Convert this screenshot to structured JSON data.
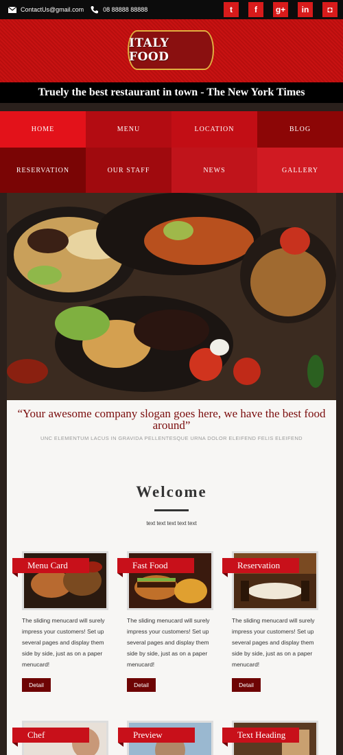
{
  "topbar": {
    "email": "ContactUs@gmail.com",
    "phone": "08 88888 88888",
    "social": [
      {
        "icon": "twitter-icon",
        "glyph": "t"
      },
      {
        "icon": "facebook-icon",
        "glyph": "f"
      },
      {
        "icon": "googleplus-icon",
        "glyph": "g+"
      },
      {
        "icon": "linkedin-icon",
        "glyph": "in"
      },
      {
        "icon": "instagram-icon",
        "glyph": "◘"
      }
    ]
  },
  "header": {
    "logo_text": "ITALY FOOD",
    "tagline": "Truely the best restaurant in town - The New York Times"
  },
  "nav": {
    "items": [
      {
        "label": "HOME",
        "color": "#e3121a"
      },
      {
        "label": "MENU",
        "color": "#b30c12"
      },
      {
        "label": "LOCATION",
        "color": "#c20e15"
      },
      {
        "label": "BLOG",
        "color": "#8c0606"
      },
      {
        "label": "RESERVATION",
        "color": "#7a0505"
      },
      {
        "label": "OUR STAFF",
        "color": "#a00a0e"
      },
      {
        "label": "NEWS",
        "color": "#c0141b"
      },
      {
        "label": "GALLERY",
        "color": "#d01a22"
      }
    ]
  },
  "content": {
    "slogan": "“Your awesome company slogan goes here, we have the best food around”",
    "subslogan": "UNC ELEMENTUM LACUS IN GRAVIDA PELLENTESQUE URNA DOLOR ELEIFEND FELIS ELEIFEND",
    "welcome_title": "Welcome",
    "welcome_sub": "text text text text text"
  },
  "cards": [
    {
      "title": "Menu Card",
      "desc": "The sliding menucard will surely impress your customers! Set up several pages and display them side by side, just as on a paper menucard!",
      "button": "Detail"
    },
    {
      "title": "Fast Food",
      "desc": "The sliding menucard will surely impress your customers! Set up several pages and display them side by side, just as on a paper menucard!",
      "button": "Detail"
    },
    {
      "title": "Reservation",
      "desc": "The sliding menucard will surely impress your customers! Set up several pages and display them side by side, just as on a paper menucard!",
      "button": "Detail"
    },
    {
      "title": "Chef",
      "desc": "",
      "button": ""
    },
    {
      "title": "Preview",
      "desc": "",
      "button": ""
    },
    {
      "title": "Text Heading",
      "desc": "",
      "button": ""
    }
  ]
}
